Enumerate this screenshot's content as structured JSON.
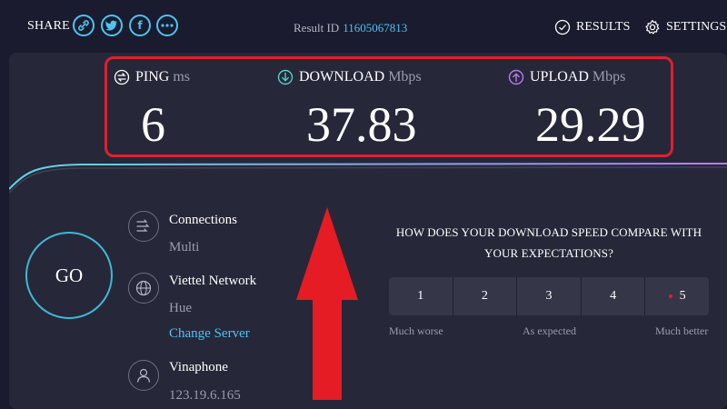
{
  "header": {
    "share_label": "SHARE",
    "share_icons": [
      "link-icon",
      "twitter-icon",
      "facebook-icon",
      "more-icon"
    ],
    "result_label": "Result ID",
    "result_id": "11605067813",
    "results_label": "RESULTS",
    "settings_label": "SETTINGS"
  },
  "metrics": {
    "ping": {
      "label": "PING",
      "unit": "ms",
      "value": "6",
      "icon": "ping-icon"
    },
    "download": {
      "label": "DOWNLOAD",
      "unit": "Mbps",
      "value": "37.83",
      "icon": "download-icon"
    },
    "upload": {
      "label": "UPLOAD",
      "unit": "Mbps",
      "value": "29.29",
      "icon": "upload-icon"
    }
  },
  "go_label": "GO",
  "connections": {
    "title": "Connections",
    "value": "Multi"
  },
  "server": {
    "title": "Viettel Network",
    "location": "Hue",
    "change_label": "Change Server"
  },
  "provider": {
    "title": "Vinaphone",
    "ip": "123.19.6.165"
  },
  "survey": {
    "question": "HOW DOES YOUR DOWNLOAD SPEED COMPARE WITH YOUR EXPECTATIONS?",
    "options": [
      "1",
      "2",
      "3",
      "4",
      "5"
    ],
    "low_label": "Much worse",
    "mid_label": "As expected",
    "high_label": "Much better"
  },
  "colors": {
    "accent": "#4ec3f0",
    "highlight": "#e0202a",
    "download_icon": "#4fd1c5",
    "upload_icon": "#b57cf0"
  }
}
